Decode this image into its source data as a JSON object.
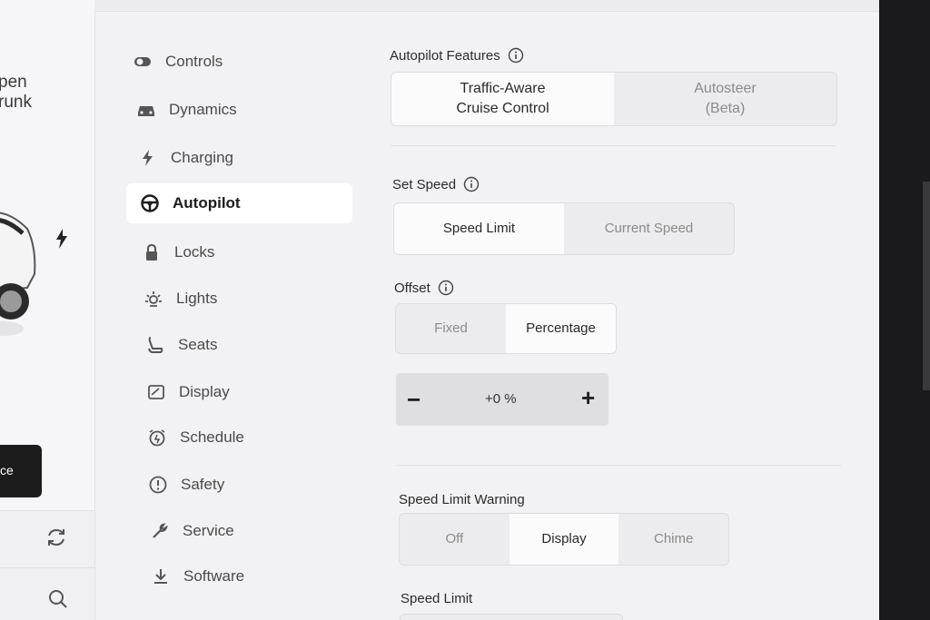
{
  "car_panel": {
    "text_line1": "pen",
    "text_line2": "runk",
    "service_label": "ce"
  },
  "nav": {
    "items": [
      {
        "label": "Controls",
        "icon": "toggle-icon"
      },
      {
        "label": "Dynamics",
        "icon": "car-icon"
      },
      {
        "label": "Charging",
        "icon": "bolt-icon"
      },
      {
        "label": "Autopilot",
        "icon": "steering-wheel-icon",
        "active": true
      },
      {
        "label": "Locks",
        "icon": "lock-icon"
      },
      {
        "label": "Lights",
        "icon": "light-icon"
      },
      {
        "label": "Seats",
        "icon": "seat-icon"
      },
      {
        "label": "Display",
        "icon": "display-icon"
      },
      {
        "label": "Schedule",
        "icon": "alarm-clock-icon"
      },
      {
        "label": "Safety",
        "icon": "alert-icon"
      },
      {
        "label": "Service",
        "icon": "wrench-icon"
      },
      {
        "label": "Software",
        "icon": "download-icon"
      }
    ]
  },
  "autopilot": {
    "features_label": "Autopilot Features",
    "features": [
      "Traffic-Aware\nCruise Control",
      "Autosteer\n(Beta)"
    ],
    "set_speed_label": "Set Speed",
    "set_speed_options": [
      "Speed Limit",
      "Current Speed"
    ],
    "offset_label": "Offset",
    "offset_options": [
      "Fixed",
      "Percentage"
    ],
    "offset_value": "+0 %",
    "offset_minus": "−",
    "offset_plus": "+",
    "warning_label": "Speed Limit Warning",
    "warning_options": [
      "Off",
      "Display",
      "Chime"
    ],
    "speed_limit_label": "Speed Limit"
  },
  "colors": {
    "screen_bg": "#f2f2f4",
    "selected_bg": "#fbfbfc",
    "bezel": "#1a1a1c"
  }
}
